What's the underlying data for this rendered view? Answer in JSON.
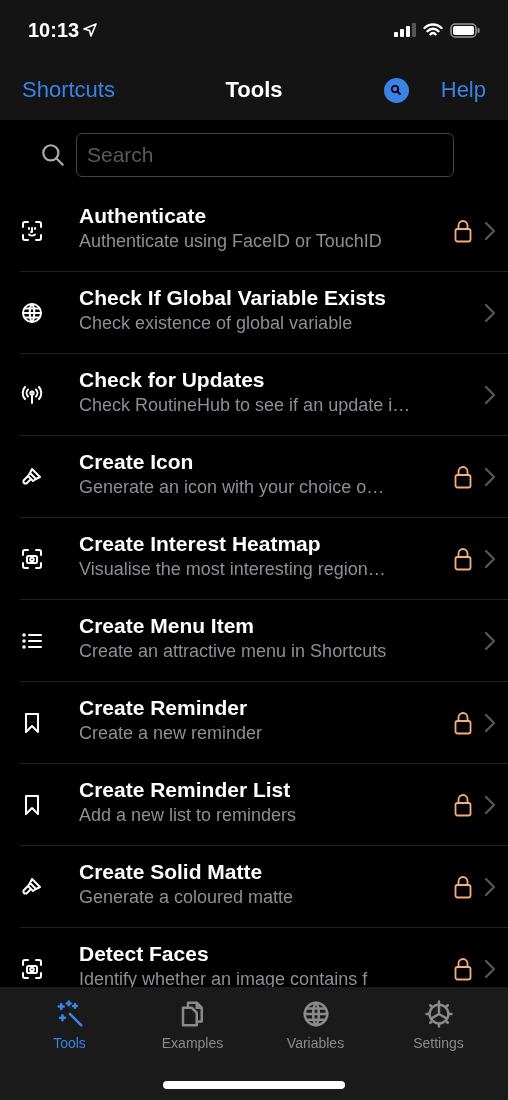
{
  "status_bar": {
    "time": "10:13"
  },
  "nav": {
    "back": "Shortcuts",
    "title": "Tools",
    "help": "Help"
  },
  "search": {
    "placeholder": "Search"
  },
  "rows": [
    {
      "title": "Authenticate",
      "subtitle": "Authenticate using FaceID or TouchID",
      "locked": true
    },
    {
      "title": "Check If Global Variable Exists",
      "subtitle": "Check existence of global variable",
      "locked": false
    },
    {
      "title": "Check for Updates",
      "subtitle": "Check RoutineHub to see if an update i…",
      "locked": false
    },
    {
      "title": "Create Icon",
      "subtitle": "Generate an icon with your choice o…",
      "locked": true
    },
    {
      "title": "Create Interest Heatmap",
      "subtitle": "Visualise the most interesting region…",
      "locked": true
    },
    {
      "title": "Create Menu Item",
      "subtitle": "Create an attractive menu in Shortcuts",
      "locked": false
    },
    {
      "title": "Create Reminder",
      "subtitle": "Create a new reminder",
      "locked": true
    },
    {
      "title": "Create Reminder List",
      "subtitle": "Add a new list to reminders",
      "locked": true
    },
    {
      "title": "Create Solid Matte",
      "subtitle": "Generate a coloured matte",
      "locked": true
    },
    {
      "title": "Detect Faces",
      "subtitle": "Identify whether an image contains f",
      "locked": true
    }
  ],
  "tabs": [
    {
      "label": "Tools",
      "selected": true
    },
    {
      "label": "Examples",
      "selected": false
    },
    {
      "label": "Variables",
      "selected": false
    },
    {
      "label": "Settings",
      "selected": false
    }
  ]
}
